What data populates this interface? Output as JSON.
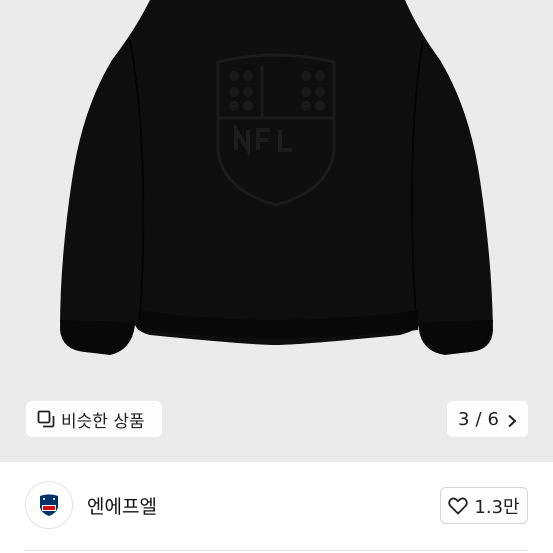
{
  "gallery": {
    "image_alt_icon": "black-fleece-jacket-with-nfl-shield-image",
    "similar_button_label": "비슷한 상품",
    "similar_icon": "copy-icon",
    "pager_current": "3",
    "pager_separator": "/",
    "pager_total": "6",
    "pager_icon": "chevron-right-icon"
  },
  "seller": {
    "avatar_icon": "nfl-shield-icon",
    "name": "엔에프엘",
    "like_count": "1.3만",
    "like_icon": "heart-outline-icon"
  },
  "colors": {
    "gallery_bg": "#ebebeb",
    "jacket": "#0d0d0d",
    "nfl_blue": "#013369",
    "nfl_red": "#d50a0a"
  }
}
